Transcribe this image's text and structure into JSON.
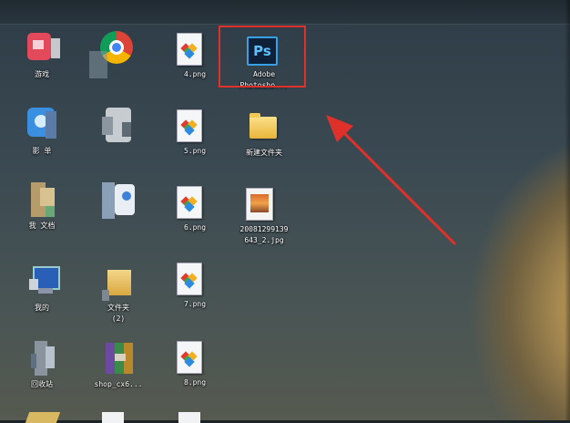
{
  "desktop": {
    "icons": [
      {
        "name": "game-app-icon",
        "label": "游戏",
        "kind": "pixelated",
        "color": "#e0495a"
      },
      {
        "name": "chrome-app-icon",
        "label": "",
        "kind": "chrome"
      },
      {
        "name": "png-file-4",
        "label": "4.png",
        "kind": "png"
      },
      {
        "name": "photoshop-app-icon",
        "label": "Adobe\nPhotosho...",
        "kind": "ps",
        "glyph_text": "Ps"
      },
      {
        "name": "video-app-icon",
        "label": "影  单",
        "kind": "pixelated",
        "color": "#3a8fe0"
      },
      {
        "name": "blurred-app-icon",
        "label": "",
        "kind": "pixelated",
        "color": "#bfc4c8"
      },
      {
        "name": "png-file-5",
        "label": "5.png",
        "kind": "png"
      },
      {
        "name": "new-folder-icon",
        "label": "新建文件夹",
        "kind": "folder"
      },
      {
        "name": "documents-icon",
        "label": "我  文档",
        "kind": "pixelated",
        "color": "#c8b07a"
      },
      {
        "name": "finder-app-icon",
        "label": "",
        "kind": "pixelated",
        "color": "#8fa8c8"
      },
      {
        "name": "png-file-6",
        "label": "6.png",
        "kind": "png"
      },
      {
        "name": "jpg-file",
        "label": "20081299139\n643_2.jpg",
        "kind": "jpg"
      },
      {
        "name": "computer-icon",
        "label": "我的",
        "kind": "pixelated",
        "color": "#3a70c0"
      },
      {
        "name": "new-folder-2-icon",
        "label": "文件夹\n(2)",
        "kind": "folder"
      },
      {
        "name": "png-file-7",
        "label": "7.png",
        "kind": "png"
      },
      {
        "name": "recycle-bin-icon",
        "label": "回收站",
        "kind": "pixelated",
        "color": "#9aa6b0"
      },
      {
        "name": "rar-archive-icon",
        "label": "shop_cx6...",
        "kind": "pixelated",
        "color": "#7a5aa8"
      },
      {
        "name": "png-file-8",
        "label": "8.png",
        "kind": "png"
      }
    ],
    "annotation": {
      "highlight_color": "#e0302a",
      "arrow_color": "#e0302a"
    }
  }
}
